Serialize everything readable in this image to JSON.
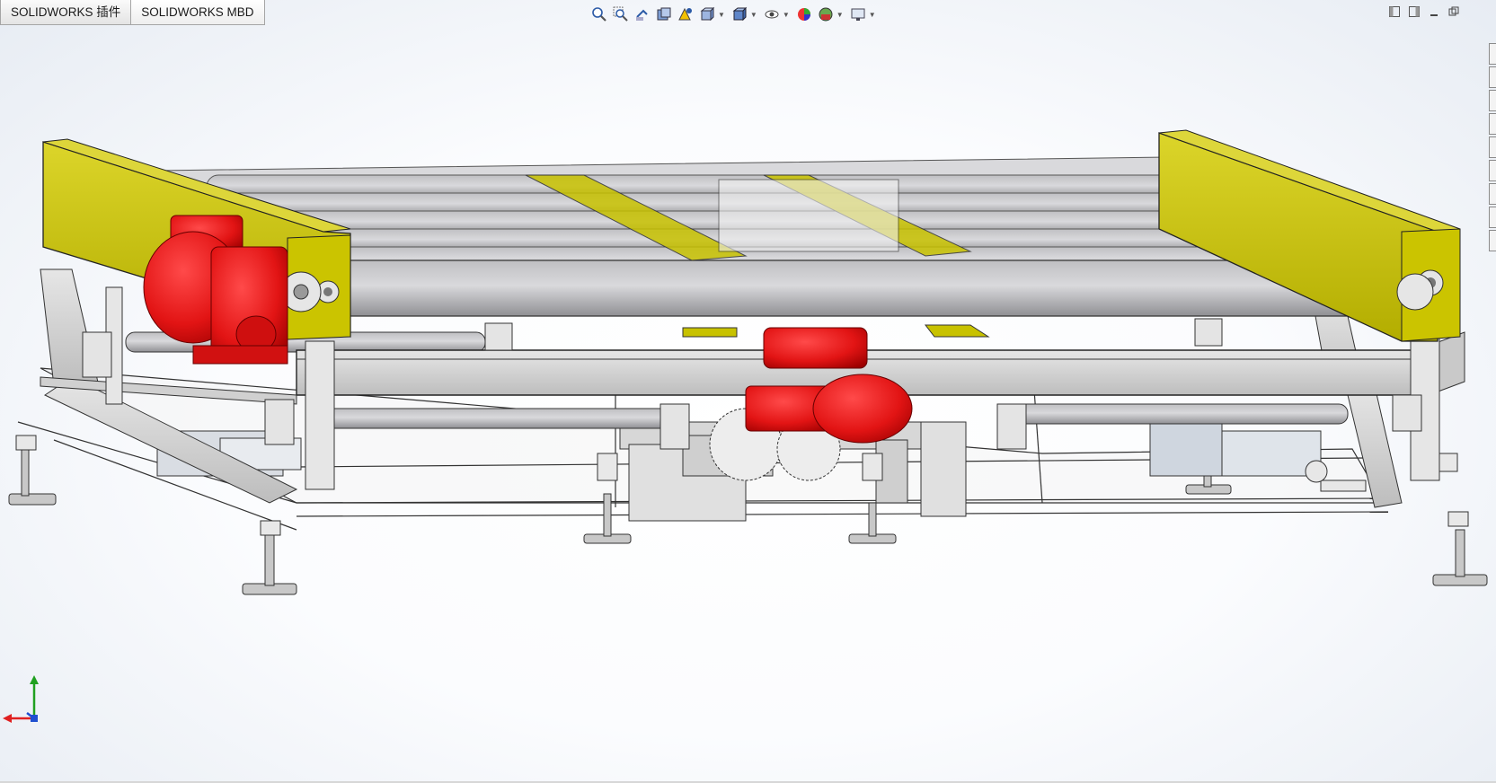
{
  "tabs": [
    {
      "label": "SOLIDWORKS 插件"
    },
    {
      "label": "SOLIDWORKS MBD"
    }
  ],
  "hud_toolbar": [
    {
      "icon": "zoom-to-fit-icon"
    },
    {
      "icon": "zoom-to-area-icon"
    },
    {
      "icon": "previous-view-icon"
    },
    {
      "icon": "section-view-icon"
    },
    {
      "icon": "dynamic-annotation-icon"
    },
    {
      "icon": "view-orientation-icon"
    },
    {
      "icon": "display-style-icon"
    },
    {
      "icon": "hide-show-items-icon"
    },
    {
      "icon": "edit-appearance-icon"
    },
    {
      "icon": "apply-scene-icon"
    },
    {
      "icon": "view-settings-icon"
    }
  ],
  "window_controls": [
    "tile-left-icon",
    "tile-right-icon",
    "minimize-icon",
    "restore-icon"
  ],
  "colors": {
    "motor_red": "#e11818",
    "rail_yellow": "#c8c200",
    "frame_gray": "#d6d6d6",
    "roller_gray": "#c9c9cc",
    "edge_dark": "#2a2a2a"
  },
  "triad": {
    "x_color": "#e02020",
    "y_color": "#20a020",
    "z_color": "#2050d0"
  }
}
